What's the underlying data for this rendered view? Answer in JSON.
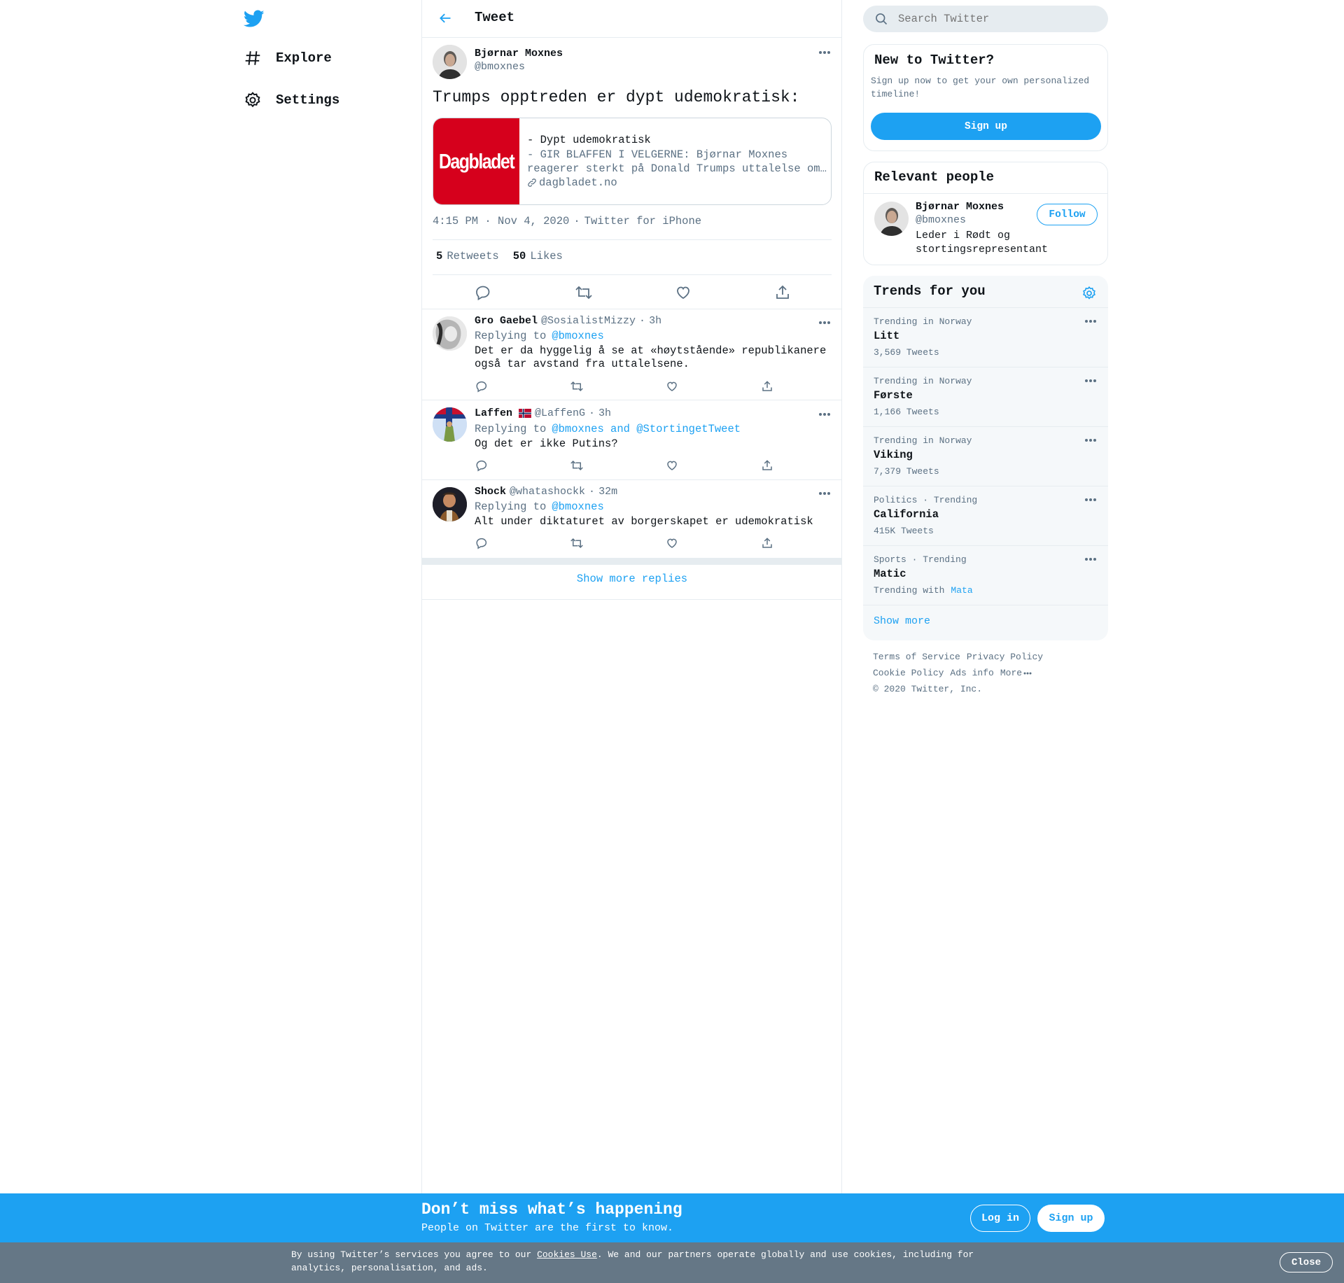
{
  "nav": {
    "explore": "Explore",
    "settings": "Settings"
  },
  "header": {
    "title": "Tweet"
  },
  "tweet": {
    "author_name": "Bjørnar Moxnes",
    "author_handle": "@bmoxnes",
    "text": "Trumps opptreden er dypt udemokratisk:",
    "card": {
      "logo_text": "Dagbladet",
      "title": "- Dypt udemokratisk",
      "description_line1": "- GIR BLAFFEN I VELGERNE: Bjørnar Moxnes",
      "description_line2": "reagerer sterkt på Donald Trumps uttalelse om…",
      "domain": "dagbladet.no"
    },
    "time": "4:15 PM · Nov 4, 2020",
    "separator": "·",
    "source": "Twitter for iPhone",
    "retweets_count": "5",
    "retweets_label": "Retweets",
    "likes_count": "50",
    "likes_label": "Likes"
  },
  "replies": [
    {
      "name": "Gro Gaebel",
      "handle": "@SosialistMizzy",
      "dot": "·",
      "time": "3h",
      "replying_label": "Replying to",
      "replying_to": "@bmoxnes",
      "text_line1": "Det er da hyggelig å se at «høytstående» republikanere",
      "text_line2": "også tar avstand fra uttalelsene."
    },
    {
      "name": "Laffen",
      "handle": "@LaffenG",
      "dot": "·",
      "time": "3h",
      "replying_label": "Replying to",
      "replying_to": "@bmoxnes and @StortingetTweet",
      "text_line1": "Og det er ikke Putins?"
    },
    {
      "name": "Shock",
      "handle": "@whatashockk",
      "dot": "·",
      "time": "32m",
      "replying_label": "Replying to",
      "replying_to": "@bmoxnes",
      "text_line1": "Alt under diktaturet av borgerskapet er udemokratisk"
    }
  ],
  "show_more_replies": "Show more replies",
  "search": {
    "placeholder": "Search Twitter"
  },
  "new_to_twitter": {
    "title": "New to Twitter?",
    "line1": "Sign up now to get your own personalized",
    "line2": "timeline!",
    "signup": "Sign up"
  },
  "relevant_people": {
    "title": "Relevant people",
    "name": "Bjørnar Moxnes",
    "handle": "@bmoxnes",
    "follow": "Follow",
    "bio_line1": "Leder i Rødt og",
    "bio_line2": "stortingsrepresentant"
  },
  "trends": {
    "title": "Trends for you",
    "items": [
      {
        "context": "Trending in Norway",
        "name": "Litt",
        "count": "3,569 Tweets"
      },
      {
        "context": "Trending in Norway",
        "name": "Første",
        "count": "1,166 Tweets"
      },
      {
        "context": "Trending in Norway",
        "name": "Viking",
        "count": "7,379 Tweets"
      },
      {
        "context": "Politics · Trending",
        "name": "California",
        "count": "415K Tweets"
      },
      {
        "context": "Sports · Trending",
        "name": "Matic",
        "count_prefix": "Trending with",
        "count_link": "Mata"
      }
    ],
    "show_more": "Show more"
  },
  "footer": {
    "terms": "Terms of Service",
    "privacy": "Privacy Policy",
    "cookie": "Cookie Policy",
    "ads": "Ads info",
    "more": "More",
    "copyright": "© 2020 Twitter, Inc."
  },
  "bottom_bar": {
    "title": "Don’t miss what’s happening",
    "subtitle": "People on Twitter are the first to know.",
    "login": "Log in",
    "signup": "Sign up"
  },
  "cookie_bar": {
    "text_before": "By using Twitter’s services you agree to our",
    "link": "Cookies Use",
    "text_after": ". We and our partners operate globally and use cookies, including for",
    "line2": "analytics, personalisation, and ads.",
    "close": "Close"
  },
  "colors": {
    "accent": "#1da1f2",
    "muted": "#5b7083",
    "divider": "#e6ecf0",
    "dagbladet_red": "#d6001c",
    "cookie_bar": "#657786"
  }
}
